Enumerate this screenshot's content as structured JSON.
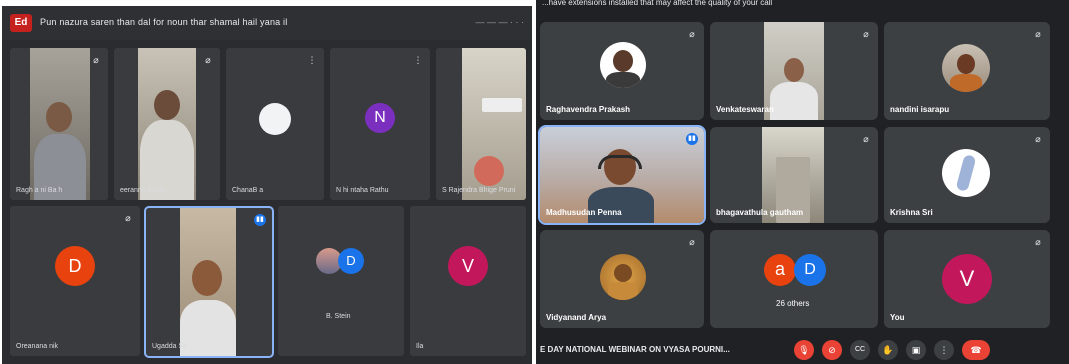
{
  "left_window": {
    "logo": "Ed",
    "title": "Pun nazura saren than dal for noun thar shamal hail yana il",
    "timer": "— — — · · ·",
    "tiles": [
      {
        "name": "Ragh a ni Ba h"
      },
      {
        "name": "eeranna Bashi"
      },
      {
        "name": "ChanaB a"
      },
      {
        "name": "N hi ntaha Rathu"
      },
      {
        "name": "S Rajendra Bhige Pruni"
      },
      {
        "name": "Oreanana nik"
      },
      {
        "name": "Ugadda Sa"
      },
      {
        "name": "B. Stein"
      },
      {
        "name": "Ila"
      }
    ],
    "avatars": {
      "tile4_letter": "N",
      "tile6_letter": "D",
      "tile8_letter": "D",
      "tile9_letter": "V"
    }
  },
  "right_window": {
    "warning": "...have extensions installed that may affect the quality of your call",
    "tiles": [
      {
        "name": "Raghavendra Prakash"
      },
      {
        "name": "Venkateswaran"
      },
      {
        "name": "nandini isarapu"
      },
      {
        "name": "Madhusudan Penna"
      },
      {
        "name": "bhagavathula gautham"
      },
      {
        "name": "Krishna Sri"
      },
      {
        "name": "Vidyanand Arya"
      },
      {
        "name": "26 others",
        "avatar_a": "a",
        "avatar_b": "D"
      },
      {
        "name": "You",
        "avatar": "V"
      }
    ],
    "meeting_title": "E DAY NATIONAL WEBINAR ON VYASA POURNI...",
    "controls": {
      "mic": "mic-off-icon",
      "camera": "camera-off-icon",
      "captions_label": "CC",
      "hand": "raise-hand-icon",
      "present": "present-icon",
      "more": "more-icon",
      "end": "end-call-icon"
    }
  },
  "colors": {
    "accent_blue": "#8ab4f8",
    "end_red": "#ea4335",
    "avatar_orange": "#e8430f",
    "avatar_blue": "#1a73e8",
    "avatar_magenta": "#c2185b",
    "avatar_purple": "#7b2fbe"
  }
}
